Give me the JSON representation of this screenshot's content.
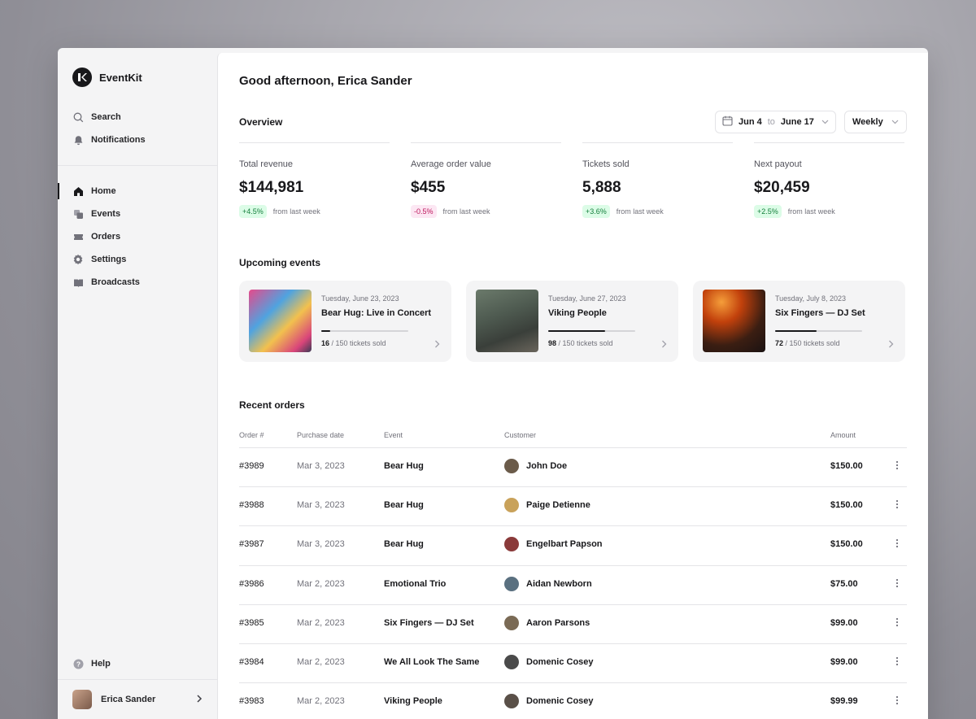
{
  "app": {
    "name": "EventKit"
  },
  "sidebar": {
    "search_label": "Search",
    "notifications_label": "Notifications",
    "items": [
      {
        "label": "Home",
        "icon": "home-icon",
        "active": true
      },
      {
        "label": "Events",
        "icon": "events-icon"
      },
      {
        "label": "Orders",
        "icon": "ticket-icon"
      },
      {
        "label": "Settings",
        "icon": "gear-icon"
      },
      {
        "label": "Broadcasts",
        "icon": "broadcast-icon"
      }
    ],
    "help_label": "Help",
    "user_name": "Erica Sander"
  },
  "header": {
    "greeting": "Good afternoon, Erica Sander"
  },
  "overview": {
    "title": "Overview",
    "date_from": "Jun 4",
    "date_to_word": "to",
    "date_to": "June 17",
    "period": "Weekly",
    "stats": [
      {
        "label": "Total revenue",
        "value": "$144,981",
        "change": "+4.5%",
        "direction": "up",
        "note": "from last week"
      },
      {
        "label": "Average order value",
        "value": "$455",
        "change": "-0.5%",
        "direction": "down",
        "note": "from last week"
      },
      {
        "label": "Tickets sold",
        "value": "5,888",
        "change": "+3.6%",
        "direction": "up",
        "note": "from last week"
      },
      {
        "label": "Next payout",
        "value": "$20,459",
        "change": "+2.5%",
        "direction": "up",
        "note": "from last week"
      }
    ]
  },
  "upcoming": {
    "title": "Upcoming events",
    "events": [
      {
        "date": "Tuesday, June 23, 2023",
        "name": "Bear Hug: Live in Concert",
        "sold": "16",
        "total_text": "/ 150 tickets sold",
        "fraction": 0.107
      },
      {
        "date": "Tuesday, June 27, 2023",
        "name": "Viking People",
        "sold": "98",
        "total_text": "/ 150 tickets sold",
        "fraction": 0.653
      },
      {
        "date": "Tuesday, July 8, 2023",
        "name": "Six Fingers — DJ Set",
        "sold": "72",
        "total_text": "/ 150 tickets sold",
        "fraction": 0.48
      }
    ]
  },
  "orders": {
    "title": "Recent orders",
    "columns": [
      "Order #",
      "Purchase date",
      "Event",
      "Customer",
      "Amount"
    ],
    "rows": [
      {
        "id": "#3989",
        "date": "Mar 3, 2023",
        "event": "Bear Hug",
        "customer": "John Doe",
        "amount": "$150.00"
      },
      {
        "id": "#3988",
        "date": "Mar 3, 2023",
        "event": "Bear Hug",
        "customer": "Paige Detienne",
        "amount": "$150.00"
      },
      {
        "id": "#3987",
        "date": "Mar 3, 2023",
        "event": "Bear Hug",
        "customer": "Engelbart Papson",
        "amount": "$150.00"
      },
      {
        "id": "#3986",
        "date": "Mar 2, 2023",
        "event": "Emotional Trio",
        "customer": "Aidan Newborn",
        "amount": "$75.00"
      },
      {
        "id": "#3985",
        "date": "Mar 2, 2023",
        "event": "Six Fingers — DJ Set",
        "customer": "Aaron Parsons",
        "amount": "$99.00"
      },
      {
        "id": "#3984",
        "date": "Mar 2, 2023",
        "event": "We All Look The Same",
        "customer": "Domenic Cosey",
        "amount": "$99.00"
      },
      {
        "id": "#3983",
        "date": "Mar 2, 2023",
        "event": "Viking People",
        "customer": "Domenic Cosey",
        "amount": "$99.99"
      }
    ]
  },
  "colors": {
    "accent": "#18181b",
    "positive_bg": "#dcfce7",
    "positive_fg": "#15803d",
    "negative_bg": "#fce7f3",
    "negative_fg": "#be185d"
  }
}
